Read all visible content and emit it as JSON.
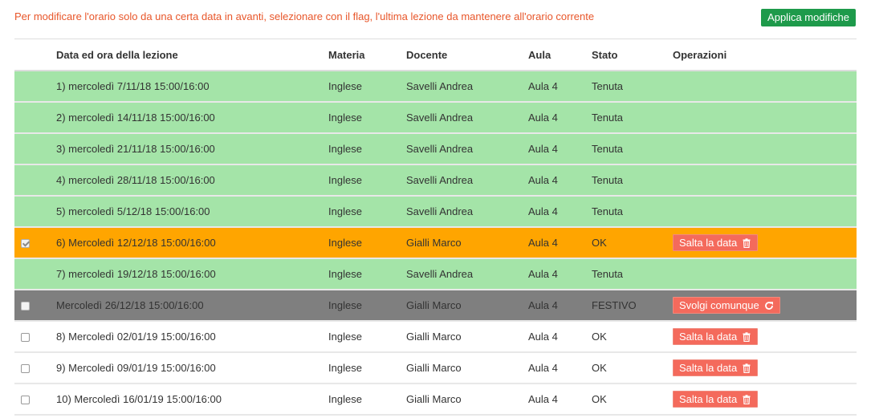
{
  "notice": "Per modificare l'orario solo da una certa data in avanti, selezionare con il flag, l'ultima lezione da mantenere all'orario corrente",
  "apply_button": "Applica modifiche",
  "colors": {
    "notice": "#e8562a",
    "apply": "#1e9a4b",
    "row_green": "#a4e4a8",
    "row_orange": "#ffa500",
    "row_gray": "#7f7f7f",
    "action_button": "#f46a5c"
  },
  "table": {
    "headers": {
      "date": "Data ed ora della lezione",
      "materia": "Materia",
      "docente": "Docente",
      "aula": "Aula",
      "stato": "Stato",
      "operazioni": "Operazioni"
    },
    "rows": [
      {
        "date": "1) mercoledì 7/11/18 15:00/16:00",
        "materia": "Inglese",
        "docente": "Savelli Andrea",
        "aula": "Aula 4",
        "stato": "Tenuta",
        "style": "green",
        "checkbox": "none",
        "action": "",
        "action_icon": ""
      },
      {
        "date": "2) mercoledì 14/11/18 15:00/16:00",
        "materia": "Inglese",
        "docente": "Savelli Andrea",
        "aula": "Aula 4",
        "stato": "Tenuta",
        "style": "green",
        "checkbox": "none",
        "action": "",
        "action_icon": ""
      },
      {
        "date": "3) mercoledì 21/11/18 15:00/16:00",
        "materia": "Inglese",
        "docente": "Savelli Andrea",
        "aula": "Aula 4",
        "stato": "Tenuta",
        "style": "green",
        "checkbox": "none",
        "action": "",
        "action_icon": ""
      },
      {
        "date": "4) mercoledì 28/11/18 15:00/16:00",
        "materia": "Inglese",
        "docente": "Savelli Andrea",
        "aula": "Aula 4",
        "stato": "Tenuta",
        "style": "green",
        "checkbox": "none",
        "action": "",
        "action_icon": ""
      },
      {
        "date": "5) mercoledì 5/12/18 15:00/16:00",
        "materia": "Inglese",
        "docente": "Savelli Andrea",
        "aula": "Aula 4",
        "stato": "Tenuta",
        "style": "green",
        "checkbox": "none",
        "action": "",
        "action_icon": ""
      },
      {
        "date": "6) Mercoledì 12/12/18 15:00/16:00",
        "materia": "Inglese",
        "docente": "Gialli Marco",
        "aula": "Aula 4",
        "stato": "OK",
        "style": "orange",
        "checkbox": "checked",
        "action": "Salta la data",
        "action_icon": "trash-icon"
      },
      {
        "date": "7) mercoledì 19/12/18 15:00/16:00",
        "materia": "Inglese",
        "docente": "Savelli Andrea",
        "aula": "Aula 4",
        "stato": "Tenuta",
        "style": "green",
        "checkbox": "none",
        "action": "",
        "action_icon": ""
      },
      {
        "date": "Mercoledì 26/12/18 15:00/16:00",
        "materia": "Inglese",
        "docente": "Gialli Marco",
        "aula": "Aula 4",
        "stato": "FESTIVO",
        "style": "gray",
        "checkbox": "disabled",
        "action": "Svolgi comunque",
        "action_icon": "refresh-icon"
      },
      {
        "date": "8) Mercoledì 02/01/19 15:00/16:00",
        "materia": "Inglese",
        "docente": "Gialli Marco",
        "aula": "Aula 4",
        "stato": "OK",
        "style": "white",
        "checkbox": "unchecked",
        "action": "Salta la data",
        "action_icon": "trash-icon"
      },
      {
        "date": "9) Mercoledì 09/01/19 15:00/16:00",
        "materia": "Inglese",
        "docente": "Gialli Marco",
        "aula": "Aula 4",
        "stato": "OK",
        "style": "white",
        "checkbox": "unchecked",
        "action": "Salta la data",
        "action_icon": "trash-icon"
      },
      {
        "date": "10) Mercoledì 16/01/19 15:00/16:00",
        "materia": "Inglese",
        "docente": "Gialli Marco",
        "aula": "Aula 4",
        "stato": "OK",
        "style": "white",
        "checkbox": "unchecked",
        "action": "Salta la data",
        "action_icon": "trash-icon"
      }
    ]
  }
}
